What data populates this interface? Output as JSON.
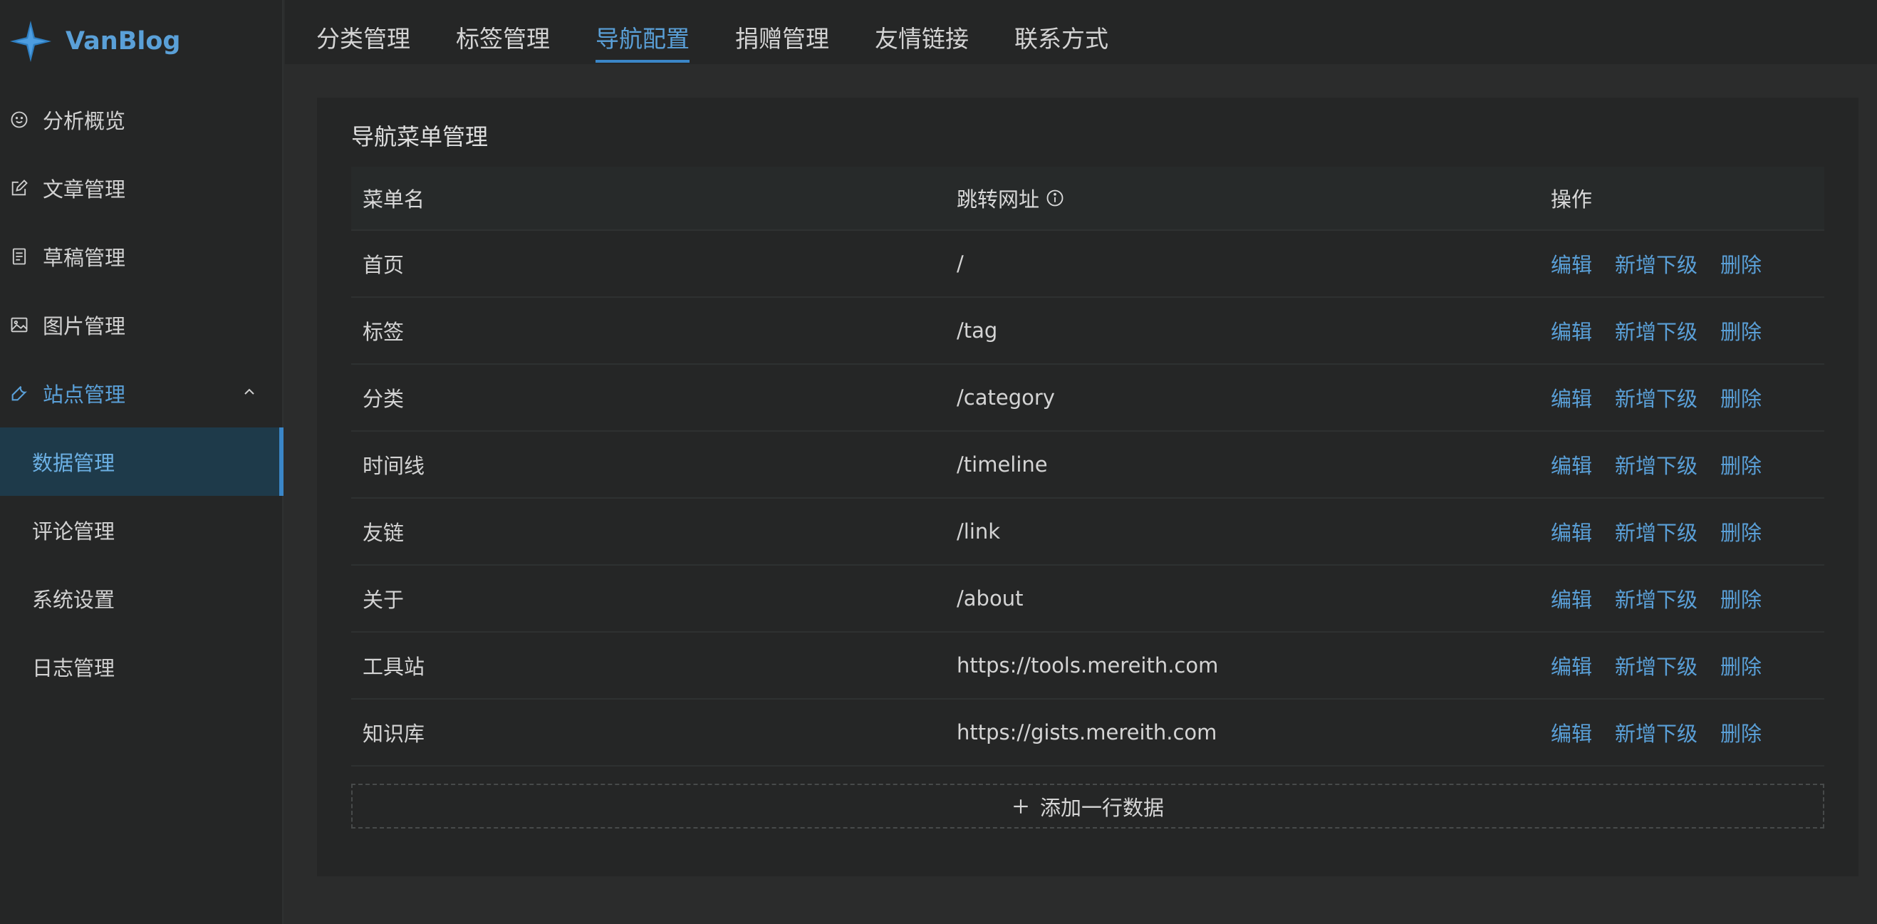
{
  "app": {
    "name": "VanBlog",
    "accent": "#5aa0d8"
  },
  "sidebar": {
    "items": [
      {
        "label": "分析概览",
        "icon": "smile-icon"
      },
      {
        "label": "文章管理",
        "icon": "edit-icon"
      },
      {
        "label": "草稿管理",
        "icon": "file-icon"
      },
      {
        "label": "图片管理",
        "icon": "picture-icon"
      },
      {
        "label": "站点管理",
        "icon": "tool-icon"
      }
    ],
    "subitems": [
      {
        "label": "数据管理"
      },
      {
        "label": "评论管理"
      },
      {
        "label": "系统设置"
      },
      {
        "label": "日志管理"
      }
    ]
  },
  "tabs": [
    {
      "label": "分类管理"
    },
    {
      "label": "标签管理"
    },
    {
      "label": "导航配置"
    },
    {
      "label": "捐赠管理"
    },
    {
      "label": "友情链接"
    },
    {
      "label": "联系方式"
    }
  ],
  "card": {
    "title": "导航菜单管理",
    "columns": {
      "name": "菜单名",
      "url": "跳转网址",
      "actions": "操作"
    },
    "actions": {
      "edit": "编辑",
      "add_child": "新增下级",
      "delete": "删除"
    },
    "rows": [
      {
        "name": "首页",
        "url": "/"
      },
      {
        "name": "标签",
        "url": "/tag"
      },
      {
        "name": "分类",
        "url": "/category"
      },
      {
        "name": "时间线",
        "url": "/timeline"
      },
      {
        "name": "友链",
        "url": "/link"
      },
      {
        "name": "关于",
        "url": "/about"
      },
      {
        "name": "工具站",
        "url": "https://tools.mereith.com"
      },
      {
        "name": "知识库",
        "url": "https://gists.mereith.com"
      }
    ],
    "add_row_label": "添加一行数据"
  }
}
